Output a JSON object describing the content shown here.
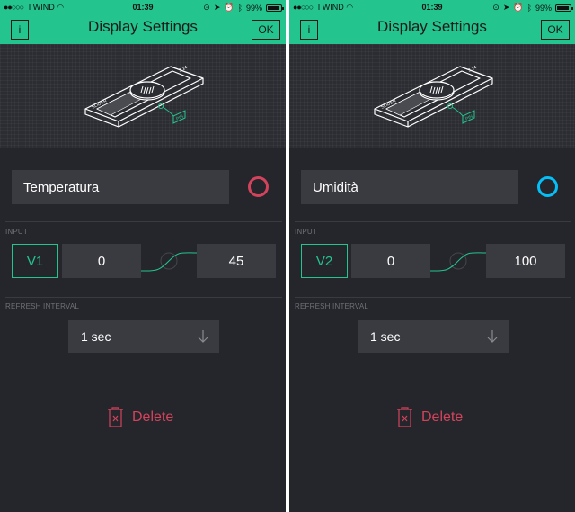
{
  "status": {
    "signal_dots": "●●○○○",
    "carrier": "I WIND",
    "time": "01:39",
    "battery": "99%"
  },
  "header": {
    "info_label": "i",
    "title": "Display Settings",
    "ok_label": "OK"
  },
  "hero": {
    "slider_text": "SLIDER",
    "version_text": "3.14",
    "pin_text": "PIN"
  },
  "labels": {
    "input": "INPUT",
    "refresh_interval": "REFRESH INTERVAL",
    "delete": "Delete"
  },
  "panels": [
    {
      "name": "Temperatura",
      "color": "#d3435c",
      "pin": "V1",
      "min": "0",
      "max": "45",
      "refresh": "1 sec"
    },
    {
      "name": "Umidità",
      "color": "#04c0f8",
      "pin": "V2",
      "min": "0",
      "max": "100",
      "refresh": "1 sec"
    }
  ],
  "colors": {
    "accent": "#23c48e",
    "background": "#25262b",
    "field": "#3a3b40",
    "danger": "#d3435c"
  }
}
